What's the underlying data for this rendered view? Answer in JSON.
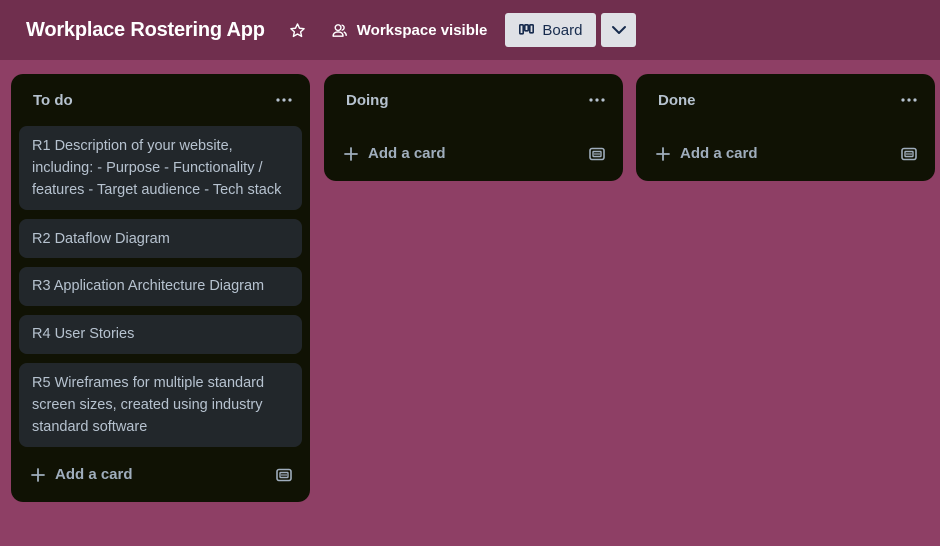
{
  "header": {
    "board_title": "Workplace Rostering App",
    "visibility_label": "Workspace visible",
    "view_label": "Board"
  },
  "lists": [
    {
      "title": "To do",
      "cards": [
        "R1 Description of your website, including: - Purpose - Functionality / features - Target audience - Tech stack",
        "R2 Dataflow Diagram",
        "R3 Application Architecture Diagram",
        "R4 User Stories",
        "R5 Wireframes for multiple standard screen sizes, created using industry standard software"
      ],
      "add_card_label": "Add a card"
    },
    {
      "title": "Doing",
      "cards": [],
      "add_card_label": "Add a card"
    },
    {
      "title": "Done",
      "cards": [],
      "add_card_label": "Add a card"
    }
  ],
  "colors": {
    "board_background": "#8e3f65",
    "header_background": "#702f4e",
    "list_background": "#101204",
    "card_background": "#22272b",
    "text_primary": "#b6c2cf"
  },
  "icons": {
    "star": "star-icon",
    "visibility": "people-icon",
    "view": "board-icon",
    "chevron": "chevron-down-icon",
    "more": "more-icon",
    "add": "plus-icon",
    "template": "card-template-icon"
  }
}
